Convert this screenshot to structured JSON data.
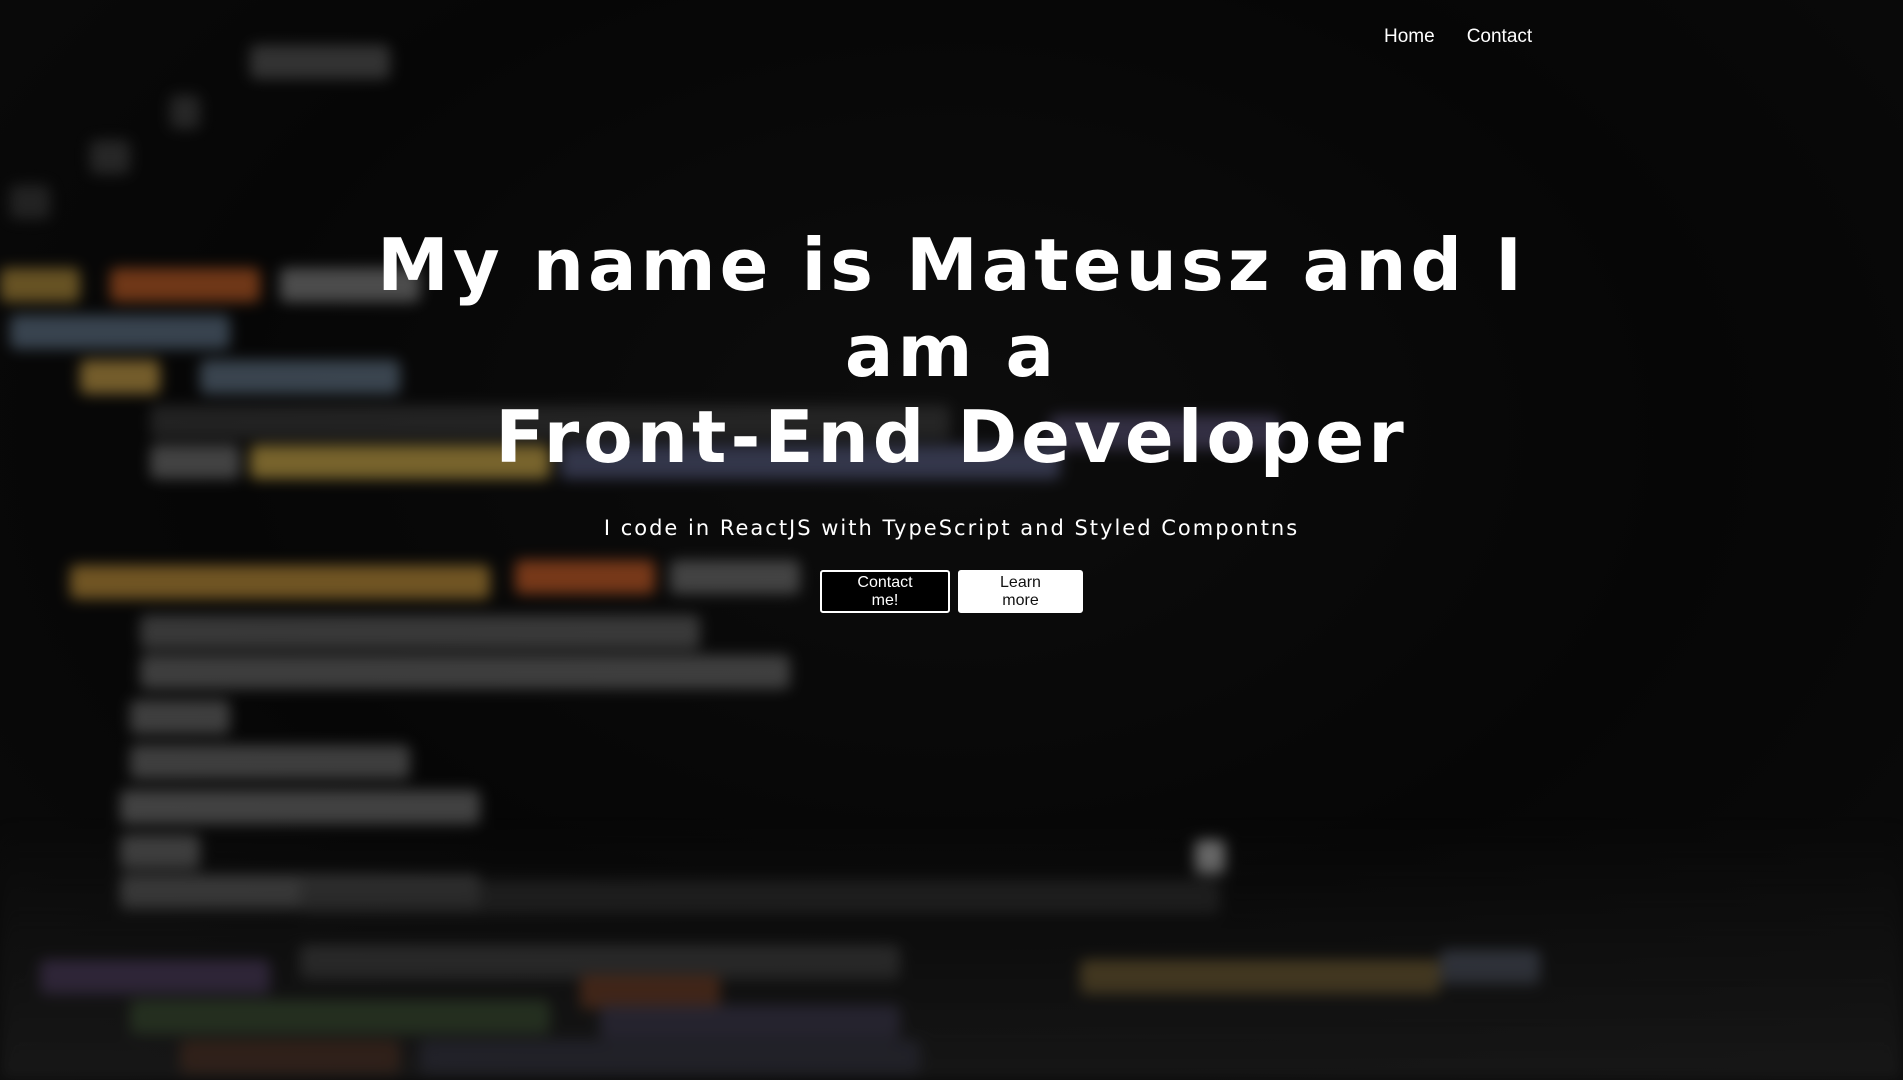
{
  "nav": {
    "items": [
      {
        "label": "Home"
      },
      {
        "label": "Contact"
      }
    ]
  },
  "hero": {
    "title_line1": "My name is Mateusz and I am a",
    "title_line2": "Front-End Developer",
    "subtitle": "I code in ReactJS with TypeScript and Styled Compontns",
    "primary_button": "Contact me!",
    "secondary_button": "Learn more"
  },
  "background": {
    "description_icon": "blurred-code-background",
    "accent_colors": [
      "#e07a2e",
      "#d9b35a",
      "#7a6fb0",
      "#6aa84f"
    ]
  }
}
